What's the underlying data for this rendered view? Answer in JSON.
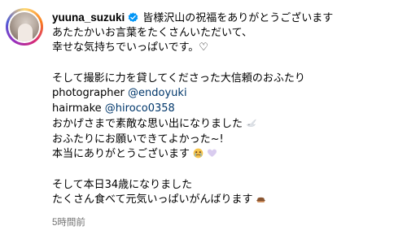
{
  "post": {
    "username": "yuuna_suzuki",
    "lines": [
      "皆様沢山の祝福をありがとうございます",
      "あたたかいお言葉をたくさんいただいて、",
      "幸せな気持ちでいっぱいです。♡",
      "そして撮影に力を貸してくださった大信頼のおふたり",
      "おかげさまで素敵な思い出になりました",
      "おふたりにお願いできてよかった~!",
      "本当にありがとうございます",
      "そして本日34歳になりました",
      "たくさん食べて元気いっぱいがんばります"
    ],
    "credits": [
      {
        "label": "photographer",
        "mention": "@endoyuki"
      },
      {
        "label": "hairmake",
        "mention": "@hiroco0358"
      }
    ],
    "timestamp": "5時間前"
  },
  "icons": {
    "verified": "verified-badge-icon",
    "dove": "dove-emoji-icon",
    "crying_face": "crying-face-emoji-icon",
    "purple_heart": "purple-heart-emoji-icon",
    "food": "food-emoji-icon"
  },
  "colors": {
    "mention": "#00376b",
    "verified": "#0095f6",
    "timestamp": "#737373"
  }
}
